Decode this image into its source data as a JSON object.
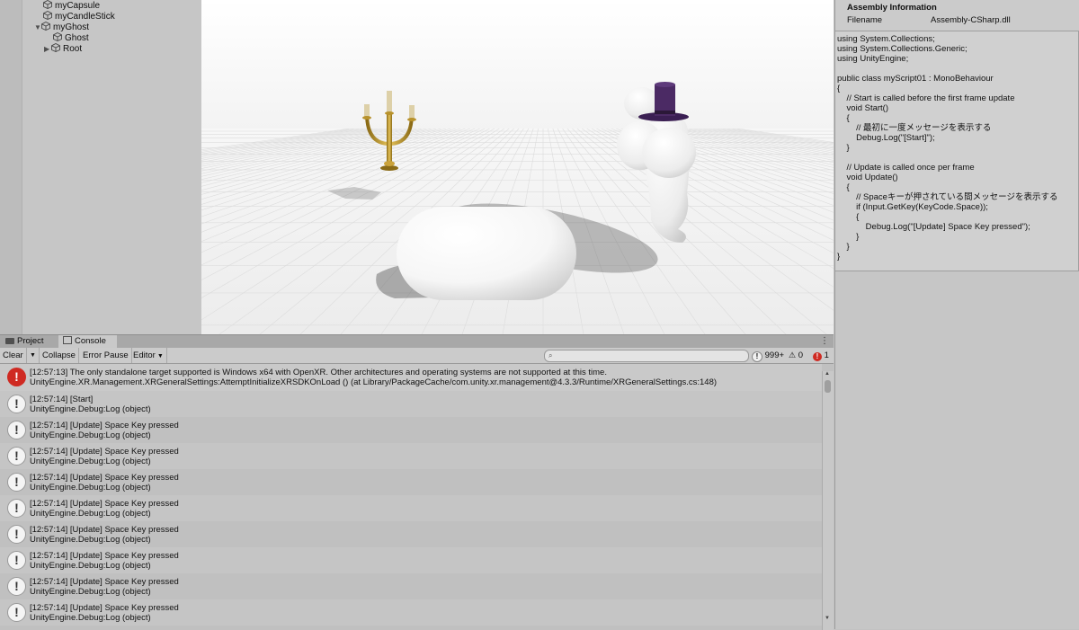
{
  "hierarchy": {
    "items": [
      {
        "label": "myCapsule"
      },
      {
        "label": "myCandleStick"
      },
      {
        "label": "myGhost"
      },
      {
        "label": "Ghost"
      },
      {
        "label": "Root"
      }
    ]
  },
  "inspector": {
    "section_title": "Assembly Information",
    "filename_label": "Filename",
    "filename_value": "Assembly-CSharp.dll",
    "code_lines": [
      "using System.Collections;",
      "using System.Collections.Generic;",
      "using UnityEngine;",
      "",
      "public class myScript01 : MonoBehaviour",
      "{",
      "    // Start is called before the first frame update",
      "    void Start()",
      "    {",
      "        // 最初に一度メッセージを表示する",
      "        Debug.Log(\"[Start]\");",
      "    }",
      "",
      "    // Update is called once per frame",
      "    void Update()",
      "    {",
      "        // Spaceキーが押されている間メッセージを表示する",
      "        if (Input.GetKey(KeyCode.Space));",
      "        {",
      "            Debug.Log(\"[Update] Space Key pressed\");",
      "        }",
      "    }",
      "}"
    ]
  },
  "console": {
    "tabs": [
      {
        "label": "Project"
      },
      {
        "label": "Console"
      }
    ],
    "toolbar": {
      "clear": "Clear",
      "collapse": "Collapse",
      "error_pause": "Error Pause",
      "editor": "Editor",
      "log_count": "999+",
      "warn_count": "0",
      "error_count": "1"
    },
    "entries": [
      {
        "type": "error",
        "line1": "[12:57:13] The only standalone target supported is Windows x64 with OpenXR.  Other architectures and operating systems are not supported at this time.",
        "line2": "UnityEngine.XR.Management.XRGeneralSettings:AttemptInitializeXRSDKOnLoad () (at Library/PackageCache/com.unity.xr.management@4.3.3/Runtime/XRGeneralSettings.cs:148)"
      },
      {
        "type": "log",
        "line1": "[12:57:14] [Start]",
        "line2": "UnityEngine.Debug:Log (object)"
      },
      {
        "type": "log",
        "line1": "[12:57:14] [Update] Space Key pressed",
        "line2": "UnityEngine.Debug:Log (object)"
      },
      {
        "type": "log",
        "line1": "[12:57:14] [Update] Space Key pressed",
        "line2": "UnityEngine.Debug:Log (object)"
      },
      {
        "type": "log",
        "line1": "[12:57:14] [Update] Space Key pressed",
        "line2": "UnityEngine.Debug:Log (object)"
      },
      {
        "type": "log",
        "line1": "[12:57:14] [Update] Space Key pressed",
        "line2": "UnityEngine.Debug:Log (object)"
      },
      {
        "type": "log",
        "line1": "[12:57:14] [Update] Space Key pressed",
        "line2": "UnityEngine.Debug:Log (object)"
      },
      {
        "type": "log",
        "line1": "[12:57:14] [Update] Space Key pressed",
        "line2": "UnityEngine.Debug:Log (object)"
      },
      {
        "type": "log",
        "line1": "[12:57:14] [Update] Space Key pressed",
        "line2": "UnityEngine.Debug:Log (object)"
      },
      {
        "type": "log",
        "line1": "[12:57:14] [Update] Space Key pressed",
        "line2": "UnityEngine.Debug:Log (object)"
      }
    ]
  },
  "colors": {
    "error_red": "#cf2a22",
    "panel_grey": "#c2c2c2",
    "candlestick_gold": "#c9a233",
    "hat_purple": "#4b2a64"
  }
}
